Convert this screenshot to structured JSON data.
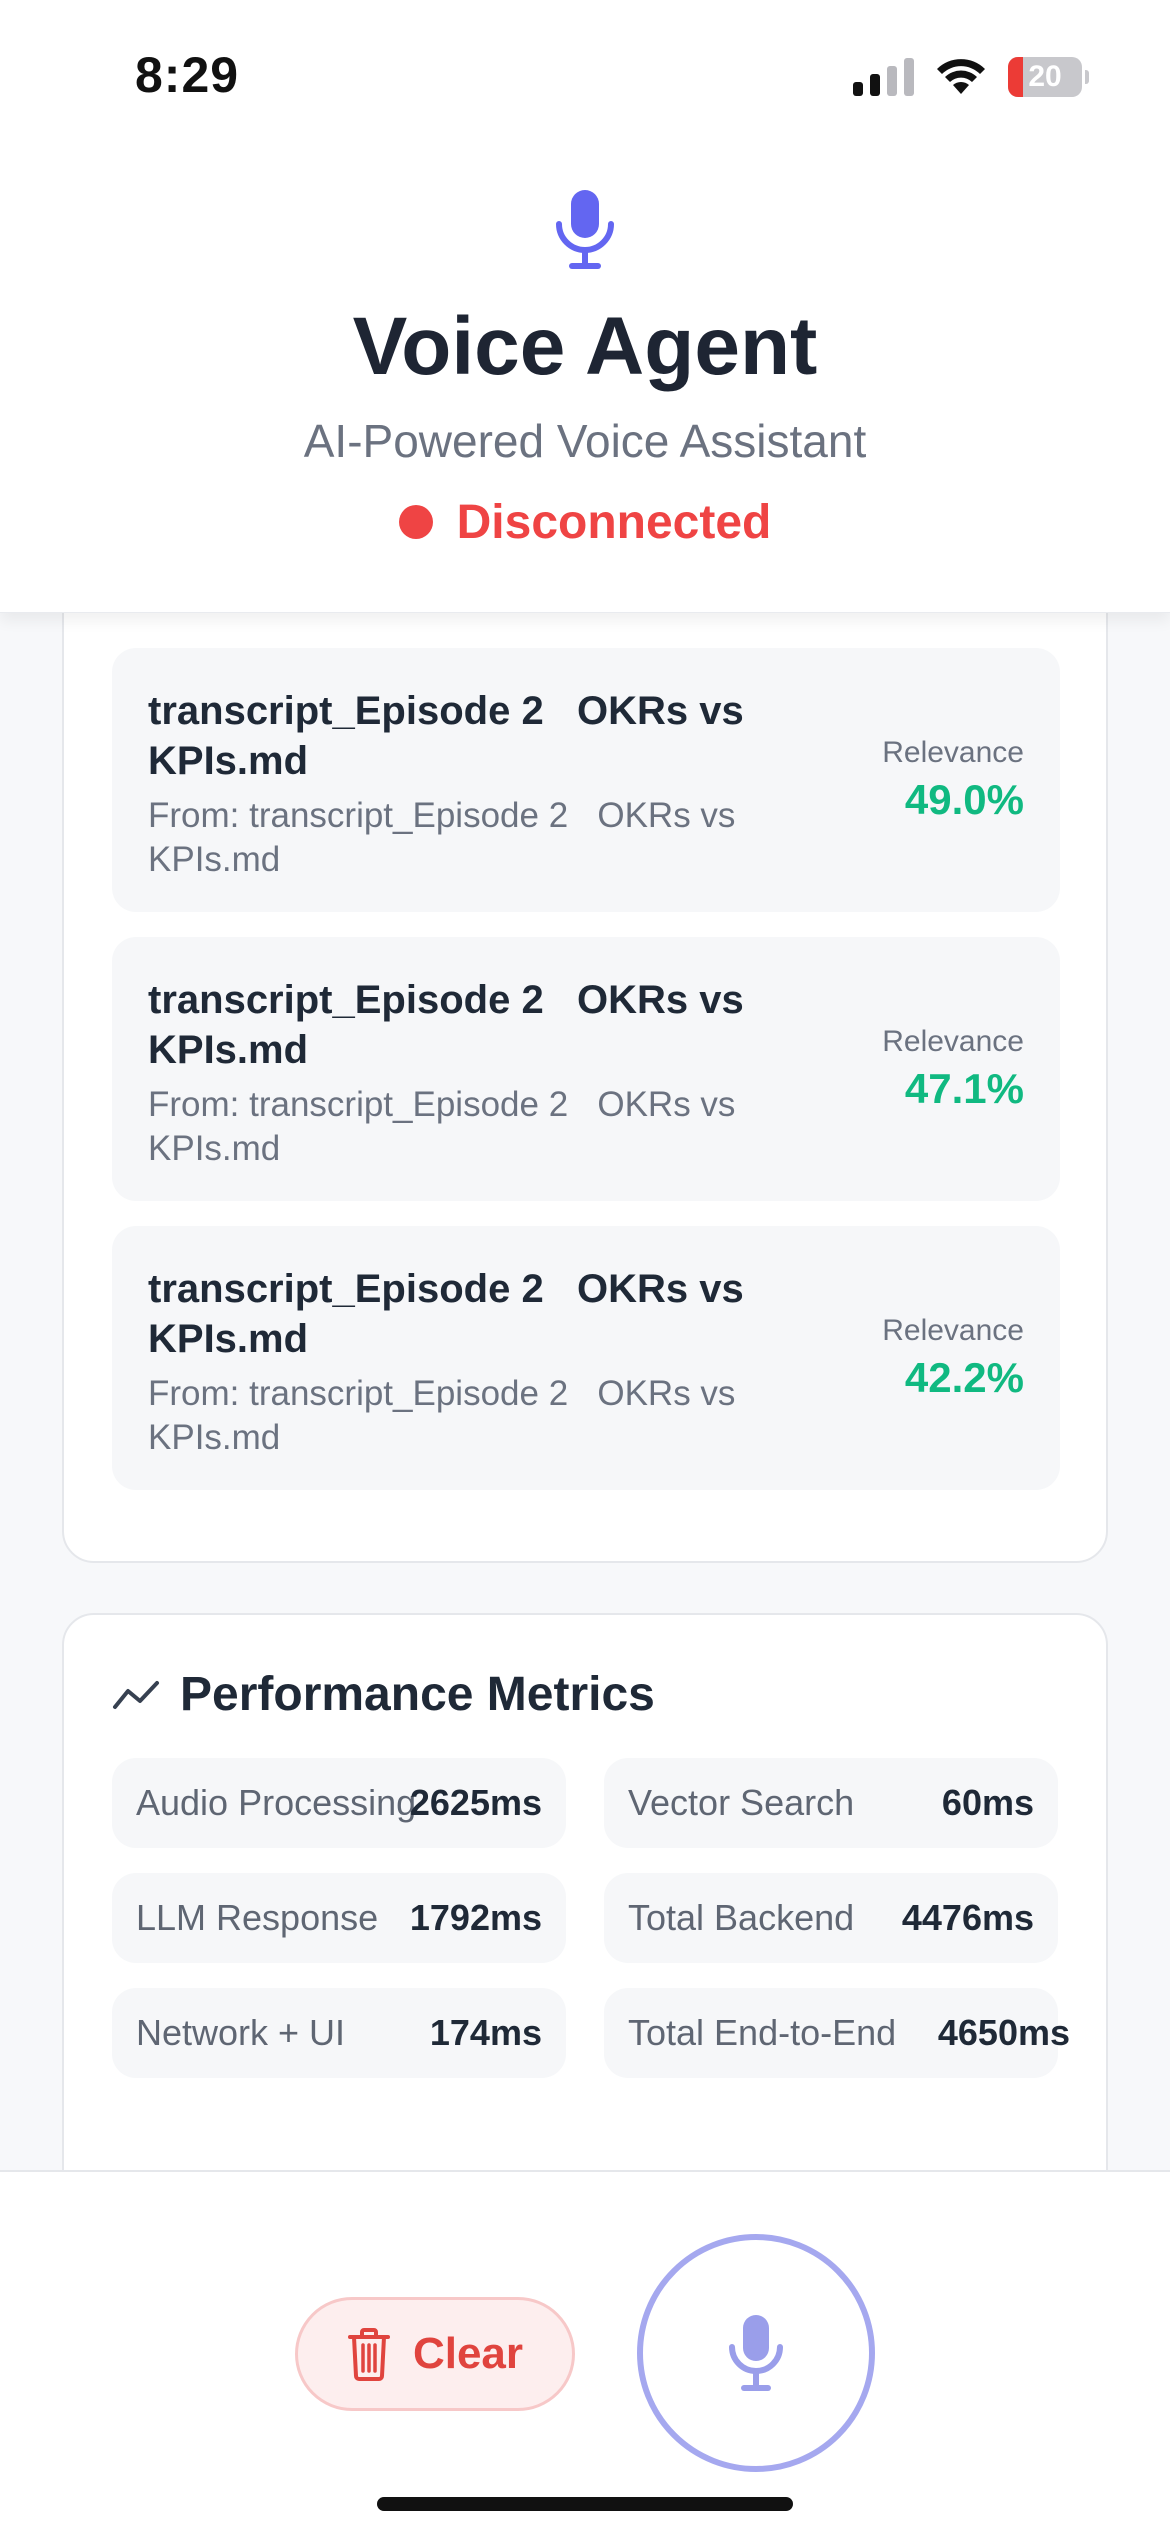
{
  "status_bar": {
    "time": "8:29",
    "battery_percent": "20",
    "battery_level": 0.2,
    "icons": [
      "cellular-signal-icon",
      "wifi-icon",
      "battery-icon"
    ]
  },
  "header": {
    "icon": "microphone-icon",
    "title": "Voice Agent",
    "subtitle": "AI-Powered Voice Assistant",
    "status": "Disconnected",
    "status_color": "#ef4444"
  },
  "sources": {
    "relevance_label": "Relevance",
    "items": [
      {
        "title": "transcript_Episode 2   OKRs vs KPIs.md",
        "from": "From: transcript_Episode 2   OKRs vs KPIs.md",
        "relevance": "49.0%"
      },
      {
        "title": "transcript_Episode 2   OKRs vs KPIs.md",
        "from": "From: transcript_Episode 2   OKRs vs KPIs.md",
        "relevance": "47.1%"
      },
      {
        "title": "transcript_Episode 2   OKRs vs KPIs.md",
        "from": "From: transcript_Episode 2   OKRs vs KPIs.md",
        "relevance": "42.2%"
      }
    ]
  },
  "performance": {
    "icon": "trend-line-icon",
    "title": "Performance Metrics",
    "metrics": [
      {
        "label": "Audio Processing",
        "value": "2625ms"
      },
      {
        "label": "Vector Search",
        "value": "60ms"
      },
      {
        "label": "LLM Response",
        "value": "1792ms"
      },
      {
        "label": "Total Backend",
        "value": "4476ms"
      },
      {
        "label": "Network + UI",
        "value": "174ms"
      },
      {
        "label": "Total End-to-End",
        "value": "4650ms"
      }
    ]
  },
  "controls": {
    "clear_label": "Clear",
    "clear_icon": "trash-icon",
    "mic_icon": "microphone-icon"
  },
  "colors": {
    "accent": "#6366f1",
    "relevance": "#10b981",
    "danger": "#ef4444"
  }
}
